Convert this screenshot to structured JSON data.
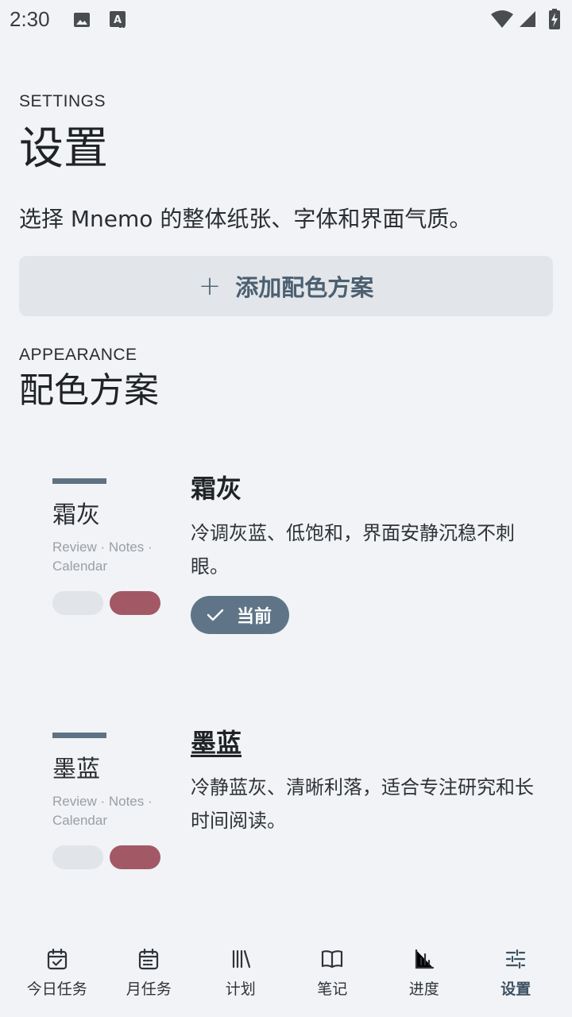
{
  "status_bar": {
    "time": "2:30",
    "icons": [
      "image-icon",
      "text-a-icon",
      "wifi-icon",
      "signal-icon",
      "battery-charging-icon"
    ]
  },
  "header": {
    "eyebrow": "SETTINGS",
    "title": "设置",
    "subtitle": "选择 Mnemo 的整体纸张、字体和界面气质。"
  },
  "add_button": {
    "icon": "plus-icon",
    "label": "添加配色方案"
  },
  "appearance": {
    "eyebrow": "APPEARANCE",
    "title": "配色方案"
  },
  "themes": [
    {
      "preview_name": "霜灰",
      "preview_tags": "Review · Notes · Calendar",
      "name": "霜灰",
      "description": "冷调灰蓝、低饱和，界面安静沉稳不刺眼。",
      "current_label": "当前",
      "is_current": true,
      "colors": {
        "bar": "#5e7283",
        "light": "#e1e5e9",
        "accent": "#a35866"
      }
    },
    {
      "preview_name": "墨蓝",
      "preview_tags": "Review · Notes · Calendar",
      "name": "墨蓝",
      "description": "冷静蓝灰、清晰利落，适合专注研究和长时间阅读。",
      "is_current": false,
      "colors": {
        "bar": "#5e7283",
        "light": "#e1e5e9",
        "accent": "#a35866"
      }
    }
  ],
  "bottom_nav": [
    {
      "label": "今日任务",
      "icon": "calendar-check-icon"
    },
    {
      "label": "月任务",
      "icon": "calendar-month-icon"
    },
    {
      "label": "计划",
      "icon": "library-icon"
    },
    {
      "label": "笔记",
      "icon": "book-open-icon"
    },
    {
      "label": "进度",
      "icon": "bar-chart-icon"
    },
    {
      "label": "设置",
      "icon": "sliders-icon",
      "active": true
    }
  ],
  "colors": {
    "background": "#f1f3f6",
    "accent": "#5f7587",
    "accent_pill": "#a35866"
  }
}
